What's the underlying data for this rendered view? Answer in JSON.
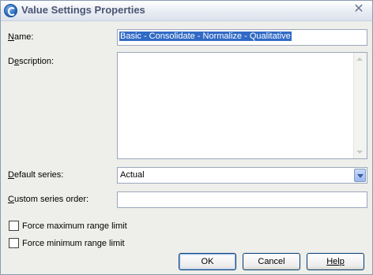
{
  "window": {
    "title": "Value Settings Properties"
  },
  "fields": {
    "name_label": "Name:",
    "name_value": "Basic - Consolidate - Normalize - Qualitative",
    "description_label": "Description:",
    "description_value": "",
    "default_series_label": "Default series:",
    "default_series_value": "Actual",
    "custom_order_label": "Custom series order:",
    "custom_order_value": ""
  },
  "options": {
    "force_max_label": "Force maximum range limit",
    "force_max_checked": false,
    "force_min_label": "Force minimum range limit",
    "force_min_checked": false
  },
  "buttons": {
    "ok": "OK",
    "cancel": "Cancel",
    "help": "Help"
  },
  "colors": {
    "selection": "#316ac5",
    "button_border": "#003c74",
    "dialog_bg": "#eeeeea"
  }
}
